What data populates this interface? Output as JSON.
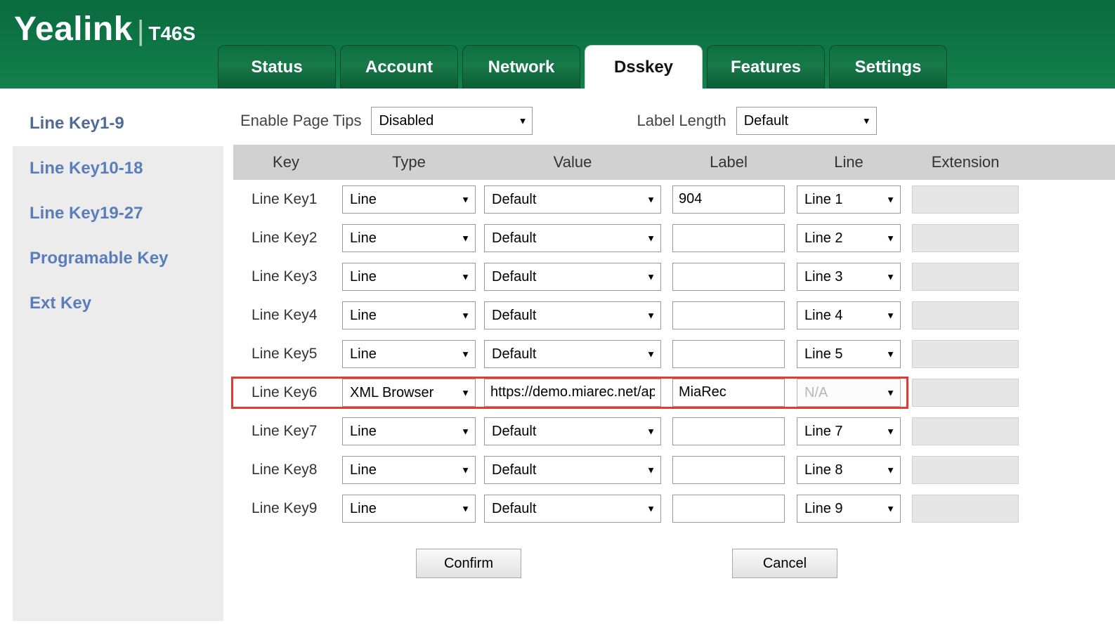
{
  "brand": {
    "name": "Yealink",
    "model": "T46S"
  },
  "nav": [
    {
      "label": "Status",
      "active": false
    },
    {
      "label": "Account",
      "active": false
    },
    {
      "label": "Network",
      "active": false
    },
    {
      "label": "Dsskey",
      "active": true
    },
    {
      "label": "Features",
      "active": false
    },
    {
      "label": "Settings",
      "active": false
    }
  ],
  "sidebar": [
    {
      "label": "Line Key1-9",
      "active": true,
      "name": "sidebar-item-line-key-1-9"
    },
    {
      "label": "Line Key10-18",
      "active": false,
      "name": "sidebar-item-line-key-10-18"
    },
    {
      "label": "Line Key19-27",
      "active": false,
      "name": "sidebar-item-line-key-19-27"
    },
    {
      "label": "Programable Key",
      "active": false,
      "name": "sidebar-item-programable-key"
    },
    {
      "label": "Ext Key",
      "active": false,
      "name": "sidebar-item-ext-key"
    }
  ],
  "top": {
    "enable_page_tips_label": "Enable Page Tips",
    "enable_page_tips_value": "Disabled",
    "label_length_label": "Label Length",
    "label_length_value": "Default"
  },
  "columns": {
    "key": "Key",
    "type": "Type",
    "value": "Value",
    "label": "Label",
    "line": "Line",
    "extension": "Extension"
  },
  "rows": [
    {
      "key": "Line Key1",
      "type": "Line",
      "value_kind": "select",
      "value": "Default",
      "label": "904",
      "line": "Line 1",
      "line_disabled": false,
      "highlight": false
    },
    {
      "key": "Line Key2",
      "type": "Line",
      "value_kind": "select",
      "value": "Default",
      "label": "",
      "line": "Line 2",
      "line_disabled": false,
      "highlight": false
    },
    {
      "key": "Line Key3",
      "type": "Line",
      "value_kind": "select",
      "value": "Default",
      "label": "",
      "line": "Line 3",
      "line_disabled": false,
      "highlight": false
    },
    {
      "key": "Line Key4",
      "type": "Line",
      "value_kind": "select",
      "value": "Default",
      "label": "",
      "line": "Line 4",
      "line_disabled": false,
      "highlight": false
    },
    {
      "key": "Line Key5",
      "type": "Line",
      "value_kind": "select",
      "value": "Default",
      "label": "",
      "line": "Line 5",
      "line_disabled": false,
      "highlight": false
    },
    {
      "key": "Line Key6",
      "type": "XML Browser",
      "value_kind": "text",
      "value": "https://demo.miarec.net/ap",
      "label": "MiaRec",
      "line": "N/A",
      "line_disabled": true,
      "highlight": true
    },
    {
      "key": "Line Key7",
      "type": "Line",
      "value_kind": "select",
      "value": "Default",
      "label": "",
      "line": "Line 7",
      "line_disabled": false,
      "highlight": false
    },
    {
      "key": "Line Key8",
      "type": "Line",
      "value_kind": "select",
      "value": "Default",
      "label": "",
      "line": "Line 8",
      "line_disabled": false,
      "highlight": false
    },
    {
      "key": "Line Key9",
      "type": "Line",
      "value_kind": "select",
      "value": "Default",
      "label": "",
      "line": "Line 9",
      "line_disabled": false,
      "highlight": false
    }
  ],
  "buttons": {
    "confirm": "Confirm",
    "cancel": "Cancel"
  }
}
